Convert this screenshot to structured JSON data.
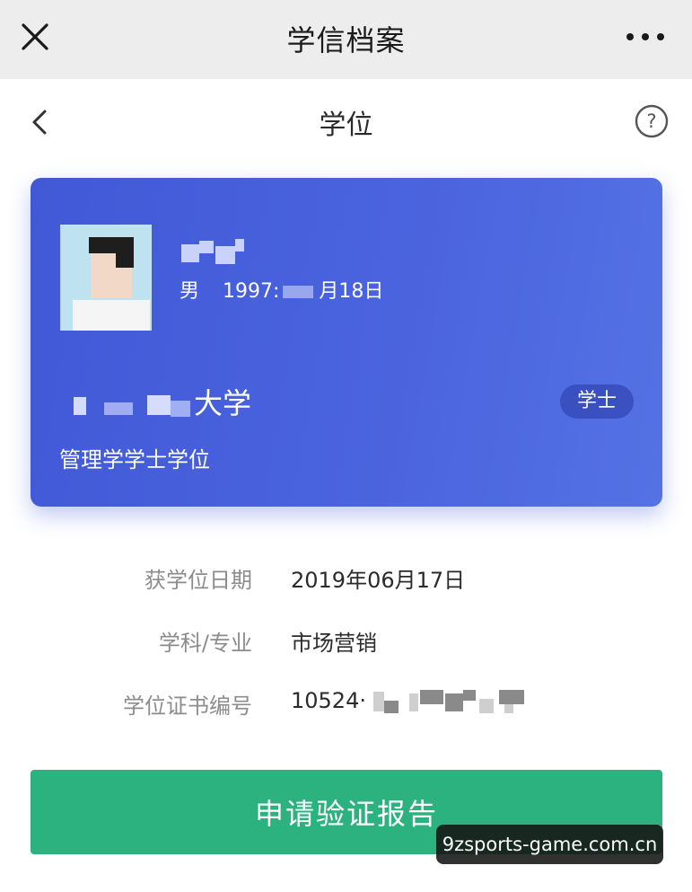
{
  "topbar": {
    "title": "学信档案",
    "close_icon": "close-icon",
    "more_icon": "more-dots-icon"
  },
  "navbar": {
    "title": "学位",
    "back_icon": "chevron-left-icon",
    "help_icon": "question-circle-icon"
  },
  "card": {
    "gender": "男",
    "birth_year": "1997:",
    "birth_rest": "月18日",
    "university": "大学",
    "degree_name": "管理学学士学位",
    "badge": "学士"
  },
  "details": [
    {
      "label": "获学位日期",
      "value": "2019年06月17日"
    },
    {
      "label": "学科/专业",
      "value": "市场营销"
    },
    {
      "label": "学位证书编号",
      "value": "10524·"
    }
  ],
  "apply_button": "申请验证报告",
  "watermark": "9zsports-game.com.cn",
  "colors": {
    "card": "#4a63de",
    "button": "#2bb27f",
    "topbar": "#ededed"
  }
}
